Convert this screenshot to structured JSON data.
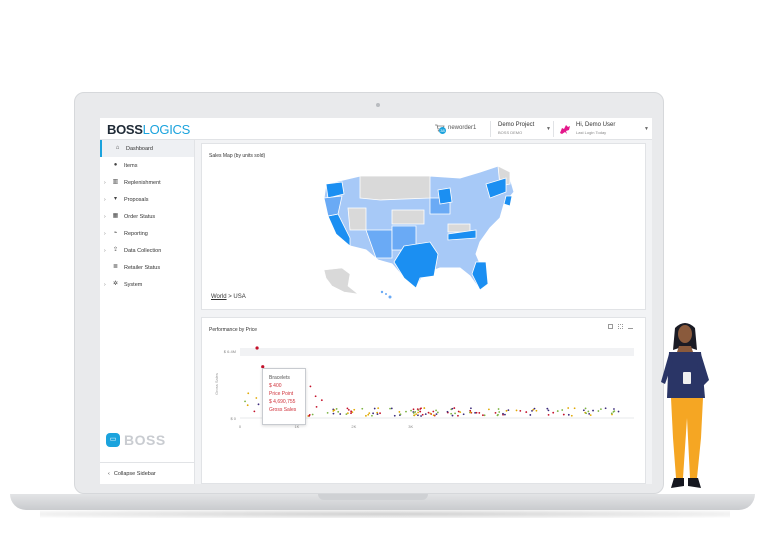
{
  "header": {
    "logo_bold": "BOSS",
    "logo_light": "LOGICS",
    "cart_count": "38",
    "order_label": "neworder1",
    "project_label": "Demo Project",
    "project_sub": "BOSS DEMO",
    "user_greeting": "Hi, Demo User",
    "user_sub": "Last Login Today"
  },
  "sidebar": {
    "items": [
      {
        "label": "Dashboard",
        "icon": "home-icon",
        "expand": false,
        "active": true
      },
      {
        "label": "Items",
        "icon": "items-icon",
        "expand": false
      },
      {
        "label": "Replenishment",
        "icon": "replenishment-icon",
        "expand": true
      },
      {
        "label": "Proposals",
        "icon": "cart-icon",
        "expand": true
      },
      {
        "label": "Order Status",
        "icon": "boxes-icon",
        "expand": true
      },
      {
        "label": "Reporting",
        "icon": "chart-icon",
        "expand": true
      },
      {
        "label": "Data Collection",
        "icon": "upload-icon",
        "expand": true
      },
      {
        "label": "Retailer Status",
        "icon": "list-icon",
        "expand": false
      },
      {
        "label": "System",
        "icon": "gears-icon",
        "expand": true
      }
    ],
    "brand": "BOSS",
    "collapse_label": "Collapse Sidebar"
  },
  "map_panel": {
    "title": "Sales Map (by units sold)",
    "crumb_world": "World",
    "crumb_sep": ">",
    "crumb_current": "USA"
  },
  "perf_panel": {
    "title": "Performance by Price",
    "tooltip": {
      "category": "Bracelets",
      "price": "$ 400",
      "price_label": "Price Point",
      "sales": "$ 4,690,755",
      "sales_label": "Gross Sales"
    }
  },
  "chart_data": {
    "type": "scatter",
    "title": "Performance by Price",
    "xlabel": "",
    "ylabel": "Gross Sales",
    "x_ticks": [
      "0",
      "1K",
      "2K",
      "3K"
    ],
    "y_ticks": [
      "$ 6.4M",
      "$ 0"
    ],
    "points": [
      {
        "x": 400,
        "y": 4690755
      },
      {
        "x": 300,
        "y": 6400000
      }
    ]
  },
  "colors": {
    "accent": "#1ba3dd",
    "map_high": "#1b8ff2",
    "map_mid": "#6aaaf5",
    "map_low": "#a7c9f7",
    "map_none": "#d9d9d9",
    "tooltip_red": "#d0313a"
  }
}
